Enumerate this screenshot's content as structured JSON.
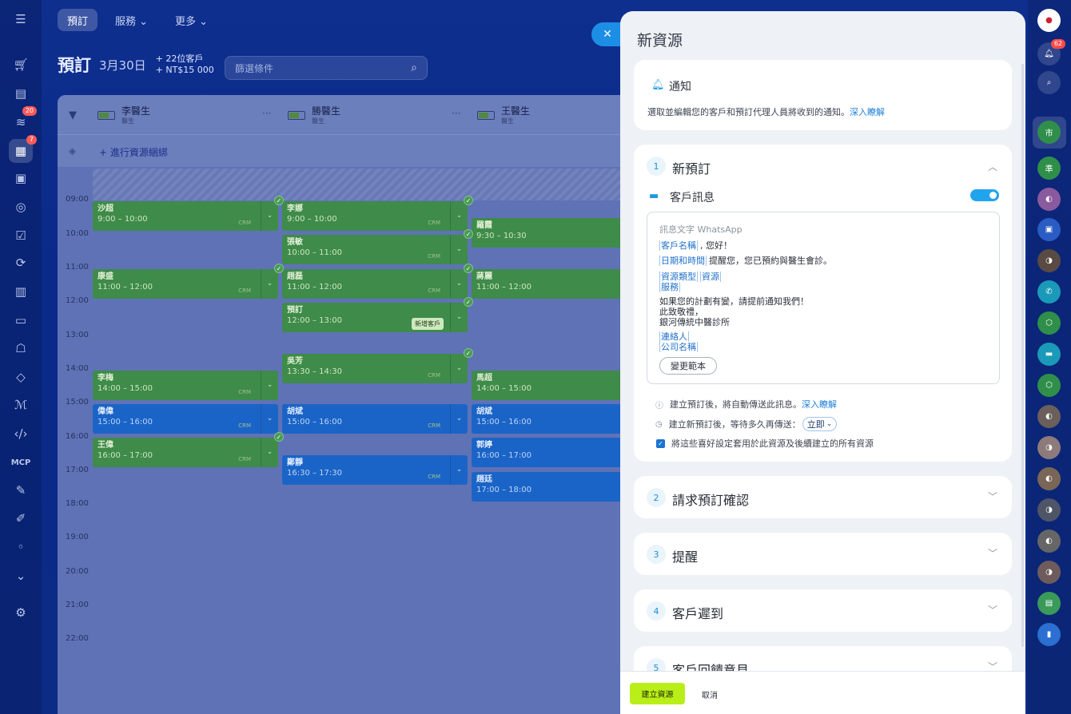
{
  "nav": {
    "items": [
      {
        "label": "預訂",
        "active": true
      },
      {
        "label": "服務 ⌄"
      },
      {
        "label": "更多 ⌄"
      }
    ]
  },
  "header": {
    "title": "預訂",
    "date": "3月30日",
    "summary_line1": "+ 22位客戶",
    "summary_line2": "+ NT$15 000",
    "filter_placeholder": "篩選條件"
  },
  "leftbar": {
    "badge_1": "20",
    "badge_2": "7",
    "mcp": "MCP"
  },
  "calendar": {
    "resources": [
      {
        "name": "李醫生",
        "role": "醫生"
      },
      {
        "name": "勝醫生",
        "role": "醫生"
      },
      {
        "name": "王醫生",
        "role": "醫生"
      }
    ],
    "add_binding": "+ 進行資源綑綁",
    "times": [
      "09:00",
      "10:00",
      "11:00",
      "12:00",
      "13:00",
      "14:00",
      "15:00",
      "16:00",
      "17:00",
      "18:00",
      "19:00",
      "20:00",
      "21:00",
      "22:00"
    ],
    "crm": "CRM",
    "events": [
      {
        "name": "沙超",
        "time": "9:00 – 10:00"
      },
      {
        "name": "康盛",
        "time": "11:00 – 12:00"
      },
      {
        "name": "李梅",
        "time": "14:00 – 15:00"
      },
      {
        "name": "偉偉",
        "time": "15:00 – 16:00"
      },
      {
        "name": "王偉",
        "time": "16:00 – 17:00"
      },
      {
        "name": "李娜",
        "time": "9:00 – 10:00"
      },
      {
        "name": "張敏",
        "time": "10:00 – 11:00"
      },
      {
        "name": "趙磊",
        "time": "11:00 – 12:00"
      },
      {
        "name": "預訂",
        "time": "12:00 – 13:00",
        "tag": "新增客戶"
      },
      {
        "name": "吳芳",
        "time": "13:30 – 14:30"
      },
      {
        "name": "胡斌",
        "time": "15:00 – 16:00"
      },
      {
        "name": "鄭靜",
        "time": "16:30 – 17:30"
      },
      {
        "name": "羅霞",
        "time": "9:30 – 10:30"
      },
      {
        "name": "蔣麗",
        "time": "11:00 – 12:00"
      },
      {
        "name": "馬超",
        "time": "14:00 – 15:00"
      },
      {
        "name": "胡斌",
        "time": "15:00 – 16:00"
      },
      {
        "name": "郭婷",
        "time": "16:00 – 17:00"
      },
      {
        "name": "趙廷",
        "time": "17:00 – 18:00"
      }
    ]
  },
  "panel": {
    "title": "新資源",
    "notify": {
      "title": "通知",
      "desc": "選取並編輯您的客戶和預訂代理人員將收到的通知。",
      "link": "深入瞭解"
    },
    "step1": {
      "num": "1",
      "title": "新預訂",
      "msg_title": "客戶訊息",
      "tpl_placeholder": "訊息文字 WhatsApp",
      "chip_client_name": "客戶名稱",
      "greet": ", 您好！",
      "chip_datetime": "日期和時間",
      "remind": "提醒您，您已預約與醫生會診。",
      "chip_res_type": "資源類型",
      "chip_res": "資源",
      "chip_service": "服務",
      "line_change": "如果您的計劃有變，請提前通知我們！",
      "line_regards": "此致敬禮，",
      "line_clinic": "銀河傳統中醫診所",
      "chip_contact": "連絡人",
      "chip_company": "公司名稱",
      "change_tpl": "變更範本",
      "opt1": "建立預訂後，將自動傳送此訊息。",
      "opt1_link": "深入瞭解",
      "opt2": "建立新預訂後，等待多久再傳送：",
      "opt2_value": "立即",
      "opt3": "將這些喜好設定套用於此資源及後續建立的所有資源"
    },
    "steps": [
      {
        "num": "2",
        "title": "請求預訂確認"
      },
      {
        "num": "3",
        "title": "提醒"
      },
      {
        "num": "4",
        "title": "客戶遲到"
      },
      {
        "num": "5",
        "title": "客戶回饋意見"
      }
    ],
    "create": "建立資源",
    "cancel": "取消"
  },
  "rightbar": {
    "notif_badge": "62",
    "avatar_1": "市",
    "avatar_2": "準"
  }
}
